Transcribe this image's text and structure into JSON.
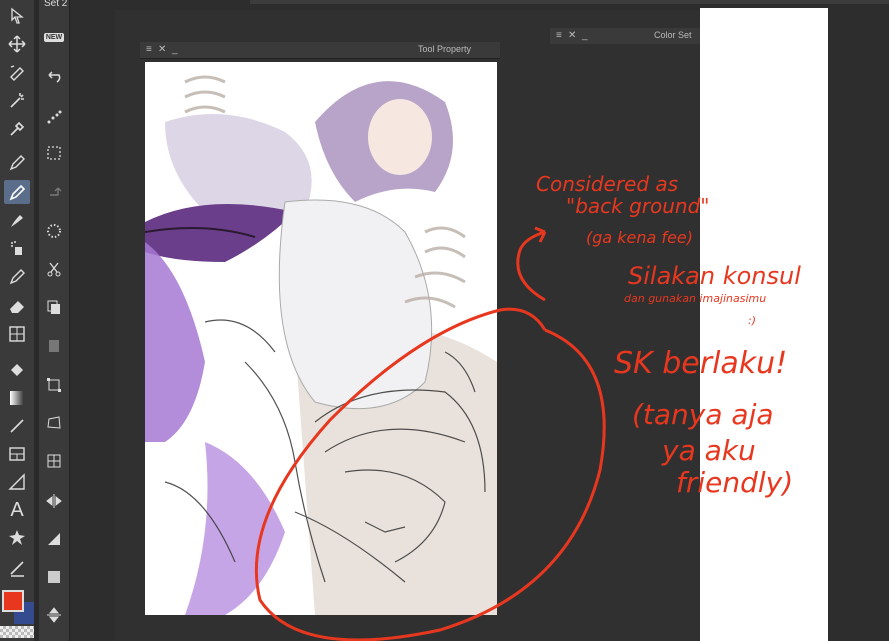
{
  "toolbar": {
    "set_label": "Set 2",
    "tools": [
      "select-icon",
      "move-icon",
      "lasso-icon",
      "magic-wand-icon",
      "eyedropper-icon",
      "pen-icon",
      "pencil-icon",
      "brush-icon",
      "airbrush-icon",
      "decoration-icon",
      "eraser-icon",
      "blend-icon",
      "fill-icon",
      "gradient-icon",
      "line-icon",
      "frame-icon",
      "ruler-icon",
      "text-icon",
      "balloon-icon",
      "correction-line-icon"
    ],
    "active_tool": "pencil-icon"
  },
  "subtools": {
    "new_badge": "NEW",
    "items": [
      "new-badge-icon",
      "undo-icon",
      "lasso-select-icon",
      "rect-select-icon",
      "redo-icon",
      "loading-icon",
      "scissors-icon",
      "copy-icon",
      "paste-icon",
      "transform-icon",
      "free-transform-icon",
      "mesh-transform-icon",
      "flip-horizontal-icon",
      "perspective-icon",
      "fill-square-icon",
      "flip-vertical-icon"
    ]
  },
  "panels": {
    "tool_property_title": "Tool Property",
    "color_set_title": "Color Set"
  },
  "colors": {
    "main_color": "#e8371f",
    "sub_color": "#344b8f",
    "annotation": "#e8371f"
  },
  "annotations": {
    "line1": "Considered as",
    "line2": "\"back ground\"",
    "line3": "(ga kena fee)",
    "line4": "Silakan konsul",
    "line5": "dan gunakan imajinasimu",
    "line6": ":)",
    "line7": "SK berlaku!",
    "line8": "(tanya aja",
    "line9": "ya aku",
    "line10": "friendly)"
  }
}
